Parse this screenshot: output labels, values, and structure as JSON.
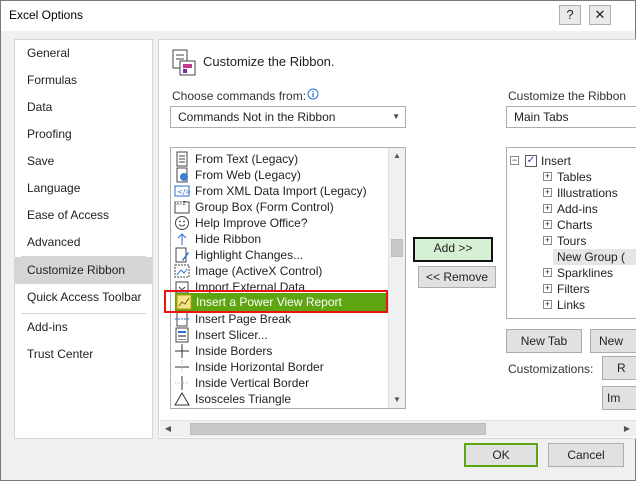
{
  "window": {
    "title": "Excel Options",
    "help_label": "?",
    "close_label": "✕"
  },
  "nav": {
    "items": [
      {
        "label": "General"
      },
      {
        "label": "Formulas"
      },
      {
        "label": "Data"
      },
      {
        "label": "Proofing"
      },
      {
        "label": "Save"
      },
      {
        "label": "Language"
      },
      {
        "label": "Ease of Access"
      },
      {
        "label": "Advanced"
      },
      {
        "label": "Customize Ribbon",
        "selected": true
      },
      {
        "label": "Quick Access Toolbar"
      },
      {
        "label": "Add-ins"
      },
      {
        "label": "Trust Center"
      }
    ]
  },
  "main": {
    "heading": "Customize the Ribbon.",
    "choose_label": "Choose commands from:",
    "info_icon": "info-icon",
    "choose_value": "Commands Not in the Ribbon",
    "commands": [
      {
        "label": "From Text (Legacy)",
        "icon": "document-icon"
      },
      {
        "label": "From Web (Legacy)",
        "icon": "web-icon"
      },
      {
        "label": "From XML Data Import (Legacy)",
        "icon": "xml-icon"
      },
      {
        "label": "Group Box (Form Control)",
        "icon": "group-box-icon"
      },
      {
        "label": "Help Improve Office?",
        "icon": "smiley-icon"
      },
      {
        "label": "Hide Ribbon",
        "icon": "hide-ribbon-icon"
      },
      {
        "label": "Highlight Changes...",
        "icon": "highlight-icon"
      },
      {
        "label": "Image (ActiveX Control)",
        "icon": "image-icon"
      },
      {
        "label": "Import External Data",
        "icon": "import-icon"
      },
      {
        "label": "Insert a Power View Report",
        "icon": "power-view-icon",
        "highlighted": true
      },
      {
        "label": "Insert Page Break",
        "icon": "page-break-icon"
      },
      {
        "label": "Insert Slicer...",
        "icon": "slicer-icon"
      },
      {
        "label": "Inside Borders",
        "icon": "inside-borders-icon"
      },
      {
        "label": "Inside Horizontal Border",
        "icon": "inside-horizontal-border-icon"
      },
      {
        "label": "Inside Vertical Border",
        "icon": "inside-vertical-border-icon"
      },
      {
        "label": "Isosceles Triangle",
        "icon": "triangle-icon"
      }
    ],
    "add_label": "Add >>",
    "remove_label": "<< Remove",
    "customize_label": "Customize the Ribbon",
    "tabs_value": "Main Tabs",
    "tree": {
      "root_label": "Insert",
      "root_checked": true,
      "children": [
        {
          "label": "Tables"
        },
        {
          "label": "Illustrations"
        },
        {
          "label": "Add-ins"
        },
        {
          "label": "Charts"
        },
        {
          "label": "Tours"
        },
        {
          "label": "New Group (",
          "selected": true
        },
        {
          "label": "Sparklines"
        },
        {
          "label": "Filters"
        },
        {
          "label": "Links"
        }
      ]
    },
    "new_tab_label": "New Tab",
    "new_group_label": "New",
    "customizations_label": "Customizations:",
    "reset_label": "R",
    "import_label": "Im"
  },
  "footer": {
    "ok_label": "OK",
    "cancel_label": "Cancel"
  }
}
